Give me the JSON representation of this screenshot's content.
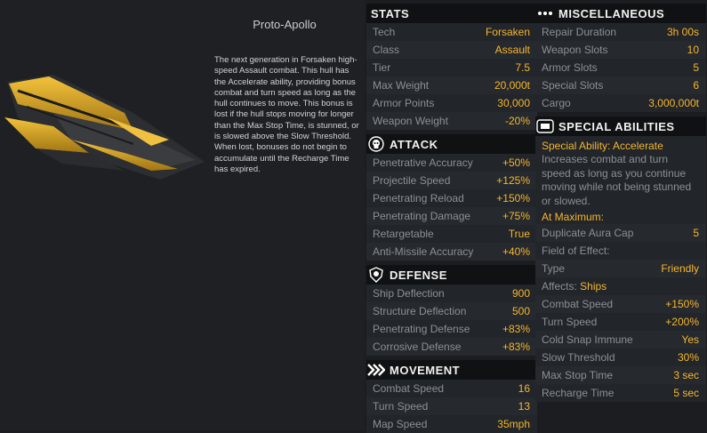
{
  "ship": {
    "name": "Proto-Apollo",
    "description": "The next generation in Forsaken high-speed Assault combat. This hull has the Accelerate ability, providing bonus combat and turn speed as long as the hull continues to move. This bonus is lost if the hull stops moving for longer than the Max Stop Time, is stunned, or is slowed above the Slow Threshold. When lost, bonuses do not begin to accumulate until the Recharge Time has expired."
  },
  "stats": {
    "title": "Stats",
    "rows": [
      {
        "label": "Tech",
        "value": "Forsaken"
      },
      {
        "label": "Class",
        "value": "Assault"
      },
      {
        "label": "Tier",
        "value": "7.5"
      },
      {
        "label": "Max Weight",
        "value": "20,000t"
      },
      {
        "label": "Armor Points",
        "value": "30,000"
      },
      {
        "label": "Weapon Weight",
        "value": "-20%"
      }
    ]
  },
  "attack": {
    "title": "Attack",
    "icon": "skull-icon",
    "rows": [
      {
        "label": "Penetrative Accuracy",
        "value": "+50%"
      },
      {
        "label": "Projectile Speed",
        "value": "+125%"
      },
      {
        "label": "Penetrating Reload",
        "value": "+150%"
      },
      {
        "label": "Penetrating Damage",
        "value": "+75%"
      },
      {
        "label": "Retargetable",
        "value": "True"
      },
      {
        "label": "Anti-Missile Accuracy",
        "value": "+40%"
      }
    ]
  },
  "defense": {
    "title": "Defense",
    "icon": "shield-icon",
    "rows": [
      {
        "label": "Ship Deflection",
        "value": "900"
      },
      {
        "label": "Structure Deflection",
        "value": "500"
      },
      {
        "label": "Penetrating Defense",
        "value": "+83%"
      },
      {
        "label": "Corrosive Defense",
        "value": "+83%"
      }
    ]
  },
  "movement": {
    "title": "Movement",
    "icon": "chevrons-icon",
    "rows": [
      {
        "label": "Combat Speed",
        "value": "16"
      },
      {
        "label": "Turn Speed",
        "value": "13"
      },
      {
        "label": "Map Speed",
        "value": "35mph"
      }
    ]
  },
  "misc": {
    "title": "Miscellaneous",
    "icon": "dots-icon",
    "rows": [
      {
        "label": "Repair Duration",
        "value": "3h 00s"
      },
      {
        "label": "Weapon Slots",
        "value": "10"
      },
      {
        "label": "Armor Slots",
        "value": "5"
      },
      {
        "label": "Special Slots",
        "value": "6"
      },
      {
        "label": "Cargo",
        "value": "3,000,000t"
      }
    ]
  },
  "special": {
    "title": "Special Abilities",
    "icon": "ability-icon",
    "name": "Special Ability: Accelerate",
    "description": "Increases combat and turn speed as long as you continue moving while not being stunned or slowed.",
    "at_max": "At Maximum:",
    "rows1": [
      {
        "label": "Duplicate Aura Cap",
        "value": "5"
      }
    ],
    "field_label": "Field of Effect:",
    "rows2": [
      {
        "label": "Type",
        "value": "Friendly"
      }
    ],
    "affects_label": "Affects:",
    "affects_value": "Ships",
    "rows3": [
      {
        "label": "Combat Speed",
        "value": "+150%"
      },
      {
        "label": "Turn Speed",
        "value": "+200%"
      },
      {
        "label": "Cold Snap Immune",
        "value": "Yes"
      },
      {
        "label": "Slow Threshold",
        "value": "30%"
      },
      {
        "label": "Max Stop Time",
        "value": "3 sec"
      },
      {
        "label": "Recharge Time",
        "value": "5 sec"
      }
    ]
  }
}
